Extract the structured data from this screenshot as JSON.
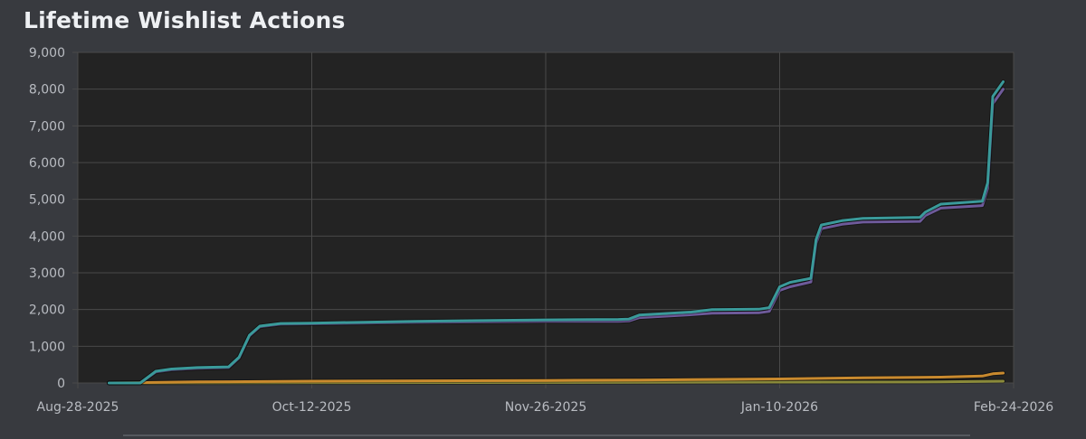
{
  "chart_data": {
    "type": "line",
    "title": "Lifetime Wishlist Actions",
    "xlabel": "",
    "ylabel": "",
    "ylim": [
      0,
      9000
    ],
    "y_ticks": [
      "0",
      "1,000",
      "2,000",
      "3,000",
      "4,000",
      "5,000",
      "6,000",
      "7,000",
      "8,000",
      "9,000"
    ],
    "x_range": [
      "2025-08-28",
      "2026-02-24"
    ],
    "x_ticks": [
      "Aug-28-2025",
      "Oct-12-2025",
      "Nov-26-2025",
      "Jan-10-2026",
      "Feb-24-2026"
    ],
    "grid": true,
    "legend": "none",
    "colors": {
      "background": "#383a3f",
      "plot_area": "#232323",
      "grid": "#4a4a4a",
      "teal": "#3a9a9a",
      "purple": "#6e5a9a",
      "orange": "#c98a2e",
      "olive": "#8a8a3a"
    },
    "series": [
      {
        "color": "teal",
        "points": [
          [
            "2025-09-03",
            0
          ],
          [
            "2025-09-09",
            0
          ],
          [
            "2025-09-12",
            320
          ],
          [
            "2025-09-15",
            380
          ],
          [
            "2025-09-20",
            420
          ],
          [
            "2025-09-26",
            440
          ],
          [
            "2025-09-28",
            700
          ],
          [
            "2025-09-30",
            1300
          ],
          [
            "2025-10-02",
            1550
          ],
          [
            "2025-10-06",
            1620
          ],
          [
            "2025-10-12",
            1630
          ],
          [
            "2025-11-01",
            1680
          ],
          [
            "2025-11-26",
            1720
          ],
          [
            "2025-12-10",
            1730
          ],
          [
            "2025-12-12",
            1740
          ],
          [
            "2025-12-14",
            1850
          ],
          [
            "2025-12-24",
            1930
          ],
          [
            "2025-12-28",
            2000
          ],
          [
            "2026-01-06",
            2010
          ],
          [
            "2026-01-08",
            2050
          ],
          [
            "2026-01-10",
            2620
          ],
          [
            "2026-01-12",
            2740
          ],
          [
            "2026-01-16",
            2850
          ],
          [
            "2026-01-17",
            3900
          ],
          [
            "2026-01-18",
            4300
          ],
          [
            "2026-01-22",
            4420
          ],
          [
            "2026-01-26",
            4480
          ],
          [
            "2026-02-06",
            4510
          ],
          [
            "2026-02-07",
            4650
          ],
          [
            "2026-02-10",
            4870
          ],
          [
            "2026-02-18",
            4950
          ],
          [
            "2026-02-19",
            5450
          ],
          [
            "2026-02-20",
            7800
          ],
          [
            "2026-02-22",
            8200
          ]
        ]
      },
      {
        "color": "purple",
        "points": [
          [
            "2025-09-03",
            0
          ],
          [
            "2025-09-09",
            0
          ],
          [
            "2025-09-12",
            300
          ],
          [
            "2025-09-15",
            360
          ],
          [
            "2025-09-20",
            400
          ],
          [
            "2025-09-26",
            420
          ],
          [
            "2025-09-28",
            680
          ],
          [
            "2025-09-30",
            1280
          ],
          [
            "2025-10-02",
            1530
          ],
          [
            "2025-10-06",
            1600
          ],
          [
            "2025-10-12",
            1610
          ],
          [
            "2025-11-01",
            1650
          ],
          [
            "2025-11-26",
            1680
          ],
          [
            "2025-12-10",
            1680
          ],
          [
            "2025-12-12",
            1690
          ],
          [
            "2025-12-14",
            1780
          ],
          [
            "2025-12-24",
            1860
          ],
          [
            "2025-12-28",
            1900
          ],
          [
            "2026-01-06",
            1910
          ],
          [
            "2026-01-08",
            1950
          ],
          [
            "2026-01-10",
            2520
          ],
          [
            "2026-01-12",
            2620
          ],
          [
            "2026-01-16",
            2750
          ],
          [
            "2026-01-17",
            3800
          ],
          [
            "2026-01-18",
            4200
          ],
          [
            "2026-01-22",
            4320
          ],
          [
            "2026-01-26",
            4380
          ],
          [
            "2026-02-06",
            4400
          ],
          [
            "2026-02-07",
            4560
          ],
          [
            "2026-02-10",
            4760
          ],
          [
            "2026-02-18",
            4830
          ],
          [
            "2026-02-19",
            5300
          ],
          [
            "2026-02-20",
            7600
          ],
          [
            "2026-02-22",
            8000
          ]
        ]
      },
      {
        "color": "orange",
        "points": [
          [
            "2025-09-03",
            0
          ],
          [
            "2025-09-20",
            30
          ],
          [
            "2025-10-12",
            50
          ],
          [
            "2025-11-26",
            70
          ],
          [
            "2025-12-14",
            80
          ],
          [
            "2026-01-10",
            110
          ],
          [
            "2026-01-26",
            140
          ],
          [
            "2026-02-10",
            160
          ],
          [
            "2026-02-18",
            190
          ],
          [
            "2026-02-20",
            250
          ],
          [
            "2026-02-22",
            270
          ]
        ]
      },
      {
        "color": "olive",
        "points": [
          [
            "2025-09-03",
            0
          ],
          [
            "2025-10-12",
            10
          ],
          [
            "2025-11-26",
            15
          ],
          [
            "2026-01-10",
            25
          ],
          [
            "2026-02-10",
            30
          ],
          [
            "2026-02-22",
            50
          ]
        ]
      }
    ]
  }
}
